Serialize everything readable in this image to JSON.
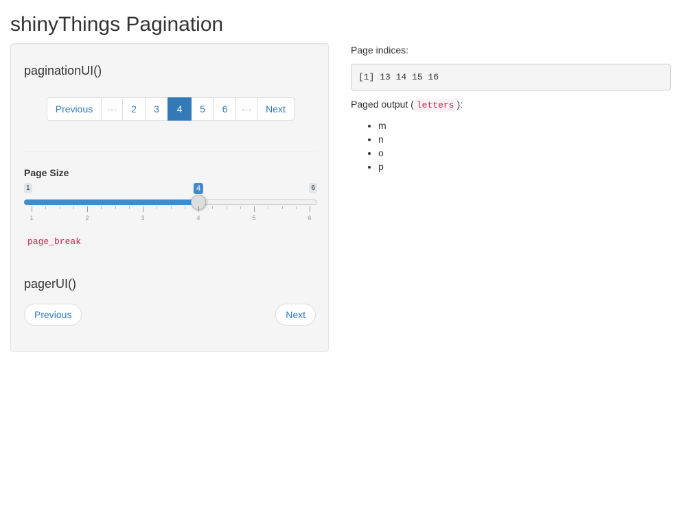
{
  "page": {
    "title": "shinyThings Pagination"
  },
  "sidebar": {
    "pagination_heading": "paginationUI()",
    "pagination": {
      "previous_label": "Previous",
      "next_label": "Next",
      "ellipsis": "···",
      "pages": [
        "2",
        "3",
        "4",
        "5",
        "6"
      ],
      "active_page": "4"
    },
    "page_size": {
      "label": "Page Size",
      "min": 1,
      "max": 6,
      "value": 4,
      "min_label": "1",
      "max_label": "6",
      "value_label": "4",
      "tick_labels": [
        "1",
        "2",
        "3",
        "4",
        "5",
        "6"
      ]
    },
    "page_break_code": "page_break",
    "pager_heading": "pagerUI()",
    "pager": {
      "previous_label": "Previous",
      "next_label": "Next"
    }
  },
  "main": {
    "indices_label": "Page indices:",
    "indices_output": "[1] 13 14 15 16",
    "paged_output_prefix": "Paged output (",
    "paged_output_code": "letters",
    "paged_output_suffix": "):",
    "items": [
      "m",
      "n",
      "o",
      "p"
    ]
  },
  "colors": {
    "link": "#337ab7",
    "active_page_bg": "#337ab7",
    "slider_fill": "#428bca",
    "code_text": "#c7254e",
    "well_bg": "#f5f5f5"
  }
}
